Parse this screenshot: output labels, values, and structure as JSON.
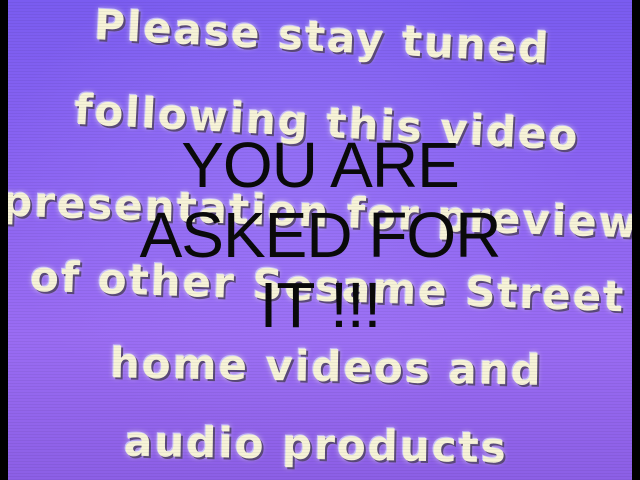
{
  "video_text": {
    "line1": "Please stay tuned",
    "line2": "following this video",
    "line3": "presentation for previews",
    "line4": "of other Sesame Street",
    "line5": "home videos and",
    "line6": "audio products"
  },
  "overlay_caption": {
    "line1": "YOU ARE",
    "line2": "ASKED FOR",
    "line3": "IT !!!"
  },
  "colors": {
    "background": "#8a63f2",
    "letters": "#f7f3d8",
    "caption": "#0a0a0a"
  }
}
